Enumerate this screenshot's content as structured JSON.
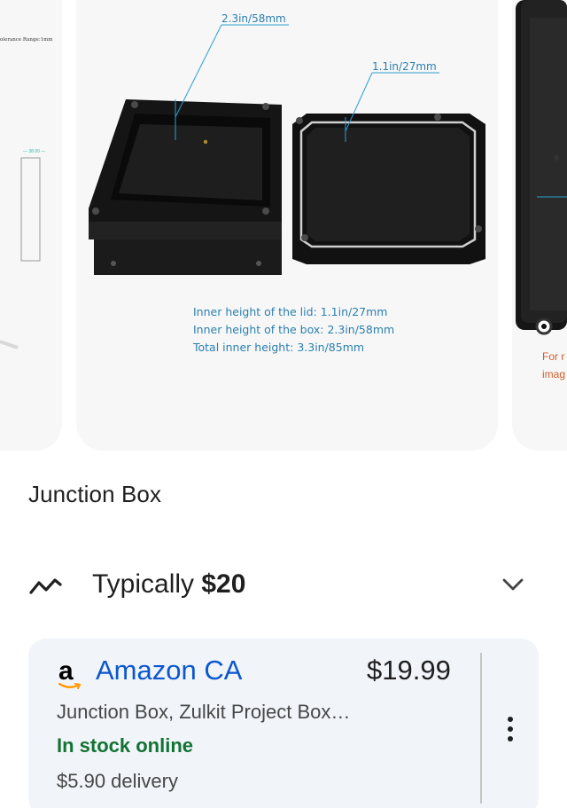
{
  "carousel": {
    "main": {
      "dim_box": "2.3in/58mm",
      "dim_lid": "1.1in/27mm",
      "spec_lines": [
        "Inner height of the lid: 1.1in/27mm",
        "Inner height of the box: 2.3in/58mm",
        "Total inner height: 3.3in/85mm"
      ]
    },
    "left": {
      "tolerance": "olerance Range:1mm",
      "tiny_dim": "— 38.00 —"
    },
    "right": {
      "note_lines": [
        "For r",
        "imag"
      ]
    }
  },
  "product": {
    "title": "Junction Box"
  },
  "price_summary": {
    "prefix": "Typically ",
    "value": "$20",
    "icon": "trend-icon",
    "expand_icon": "chevron-down-icon"
  },
  "offer": {
    "store": "Amazon CA",
    "logo_letter": "a",
    "price": "$19.99",
    "description": "Junction Box, Zulkit Project Box…",
    "stock": "In stock online",
    "delivery": "$5.90 delivery",
    "colors": {
      "store_link": "#0b57d0",
      "stock": "#137333",
      "amazon_smile": "#ff9900"
    }
  }
}
